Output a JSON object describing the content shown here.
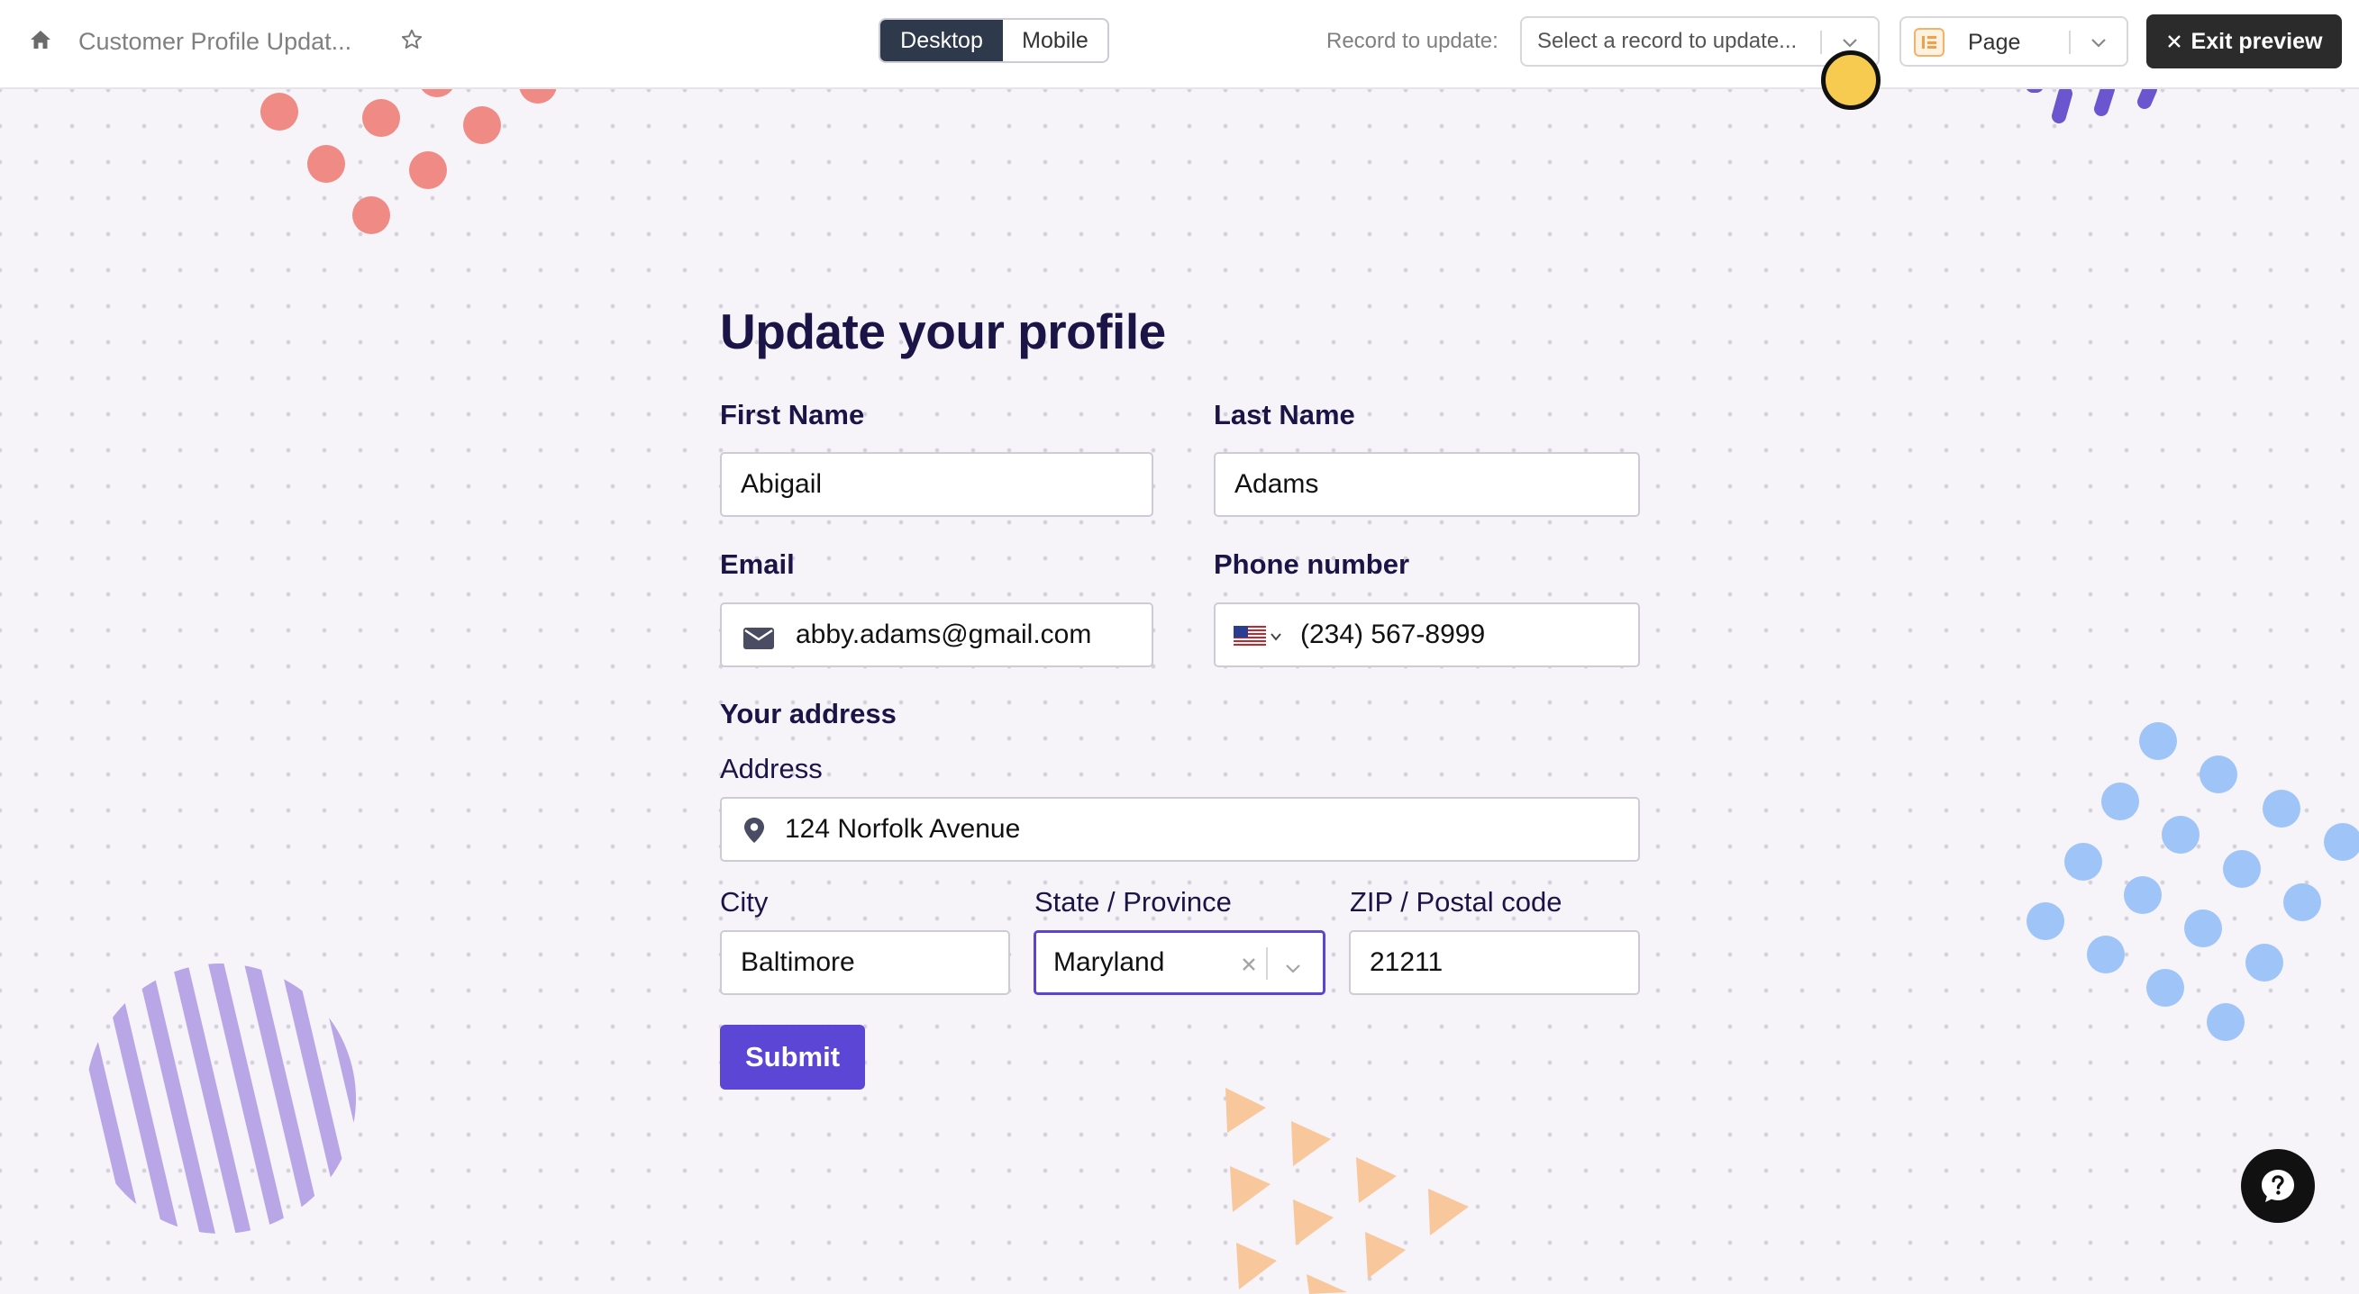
{
  "topbar": {
    "app_title": "Customer Profile Updat...",
    "view_toggle": {
      "desktop": "Desktop",
      "mobile": "Mobile",
      "active": "Desktop"
    },
    "record_label": "Record to update:",
    "record_placeholder": "Select a record to update...",
    "page_select": "Page",
    "exit_label": "Exit preview"
  },
  "form": {
    "title": "Update your profile",
    "first_name": {
      "label": "First Name",
      "value": "Abigail"
    },
    "last_name": {
      "label": "Last Name",
      "value": "Adams"
    },
    "email": {
      "label": "Email",
      "value": "abby.adams@gmail.com"
    },
    "phone": {
      "label": "Phone number",
      "value": "(234) 567-8999",
      "country": "US"
    },
    "address_section": "Your address",
    "address": {
      "label": "Address",
      "value": "124 Norfolk Avenue"
    },
    "city": {
      "label": "City",
      "value": "Baltimore"
    },
    "state": {
      "label": "State / Province",
      "value": "Maryland"
    },
    "zip": {
      "label": "ZIP / Postal code",
      "value": "21211"
    },
    "submit_label": "Submit"
  },
  "icons": {
    "home": "home-icon",
    "star": "star-icon",
    "email": "envelope-icon",
    "address": "map-pin-icon",
    "help": "help-chat-icon",
    "flag": "us-flag-icon"
  },
  "colors": {
    "accent": "#5b46d6",
    "title": "#1b1446",
    "exit_button": "#2b2b2b",
    "cursor": "#f6cb4f"
  }
}
